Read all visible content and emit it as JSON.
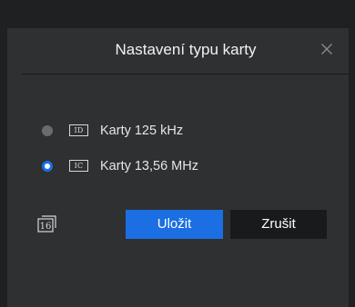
{
  "dialog": {
    "title": "Nastavení typu karty",
    "close_icon": "close-icon"
  },
  "options": [
    {
      "badge": "ID",
      "label": "Karty 125 kHz",
      "selected": false
    },
    {
      "badge": "IC",
      "label": "Karty 13,56 MHz",
      "selected": true
    }
  ],
  "card_icon": {
    "label": "16",
    "icon": "card-reader-icon"
  },
  "buttons": {
    "save_label": "Uložit",
    "cancel_label": "Zrušit"
  },
  "colors": {
    "background": "#1f2021",
    "dialog": "#2f3031",
    "accent": "#1b6fe3",
    "cancel_button": "#191a1b",
    "text": "#e6e6e6",
    "radio_unselected": "#6a6b6c"
  }
}
